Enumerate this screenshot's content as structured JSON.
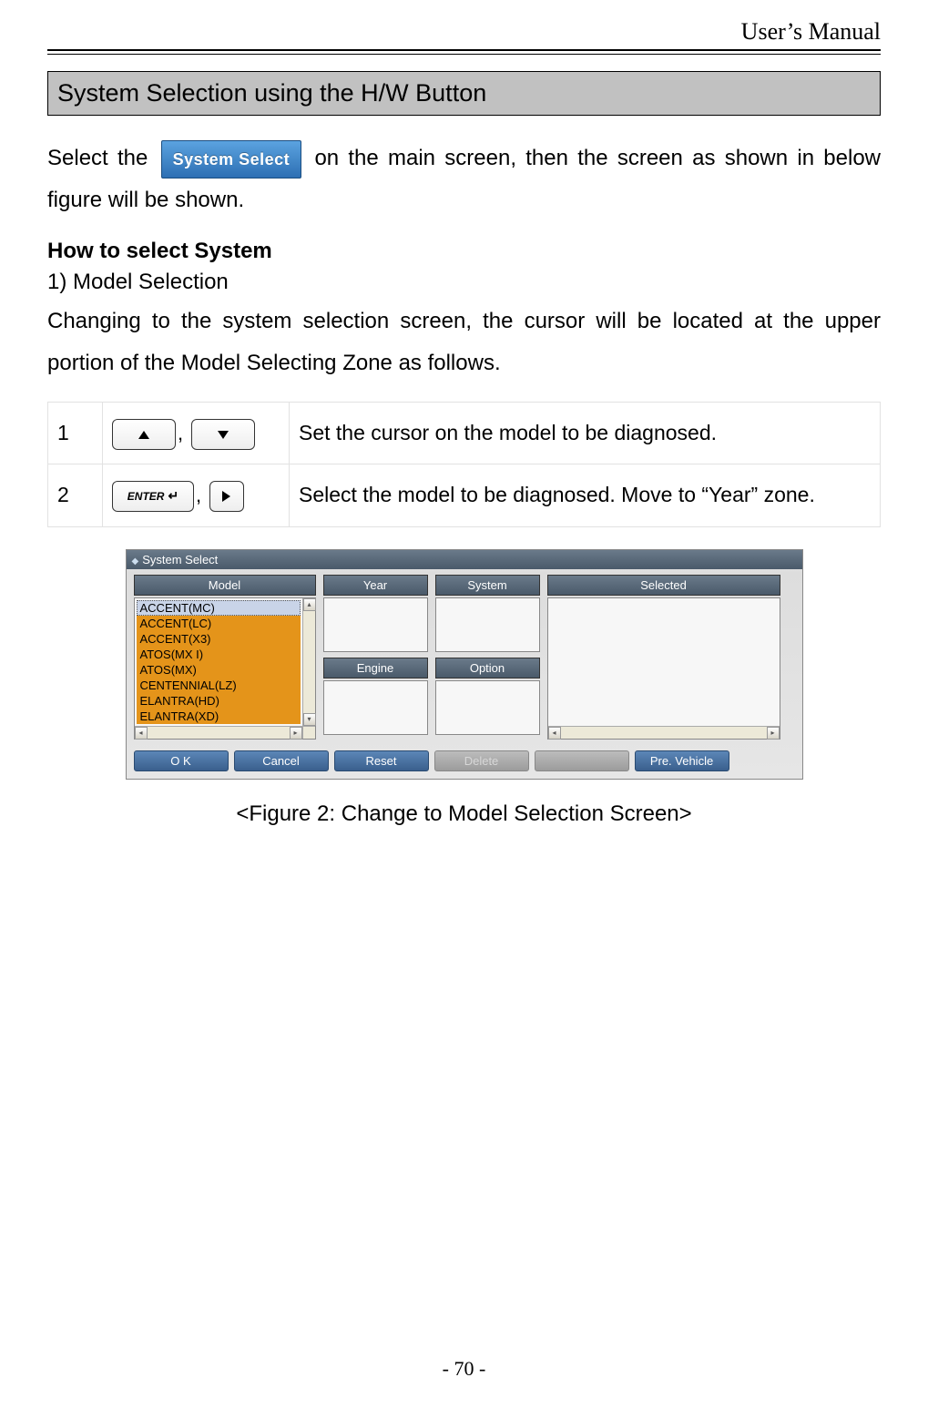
{
  "header": {
    "running_head": "User’s Manual"
  },
  "section": {
    "title": "System Selection using the H/W Button"
  },
  "intro": {
    "before": " Select the ",
    "button_label": "System Select",
    "after": " on the main screen, then the screen as shown in below figure will be shown.",
    "part2": "shown in below figure will be shown."
  },
  "subhead": "How to select System",
  "model_selection": {
    "number": "1) Model Selection",
    "para": "Changing to the system selection screen, the cursor will be located at the upper portion of the Model Selecting Zone as follows."
  },
  "table": {
    "rows": [
      {
        "num": "1",
        "keys": [
          "up",
          "down"
        ],
        "desc": "Set the cursor on the model to be diagnosed."
      },
      {
        "num": "2",
        "keys": [
          "enter",
          "right"
        ],
        "desc": "Select the model to be diagnosed. Move to “Year” zone."
      }
    ],
    "enter_label": "ENTER"
  },
  "figure": {
    "title": "System Select",
    "panes": {
      "model": "Model",
      "year": "Year",
      "system": "System",
      "engine": "Engine",
      "option": "Option",
      "selected": "Selected"
    },
    "models": [
      "ACCENT(MC)",
      "ACCENT(LC)",
      "ACCENT(X3)",
      "ATOS(MX I)",
      "ATOS(MX)",
      "CENTENNIAL(LZ)",
      "ELANTRA(HD)",
      "ELANTRA(XD)"
    ],
    "buttons": {
      "ok": "O K",
      "cancel": "Cancel",
      "reset": "Reset",
      "delete": "Delete",
      "pre_vehicle": "Pre. Vehicle"
    }
  },
  "caption": "<Figure 2: Change to Model Selection Screen>",
  "page_number": "- 70 -"
}
